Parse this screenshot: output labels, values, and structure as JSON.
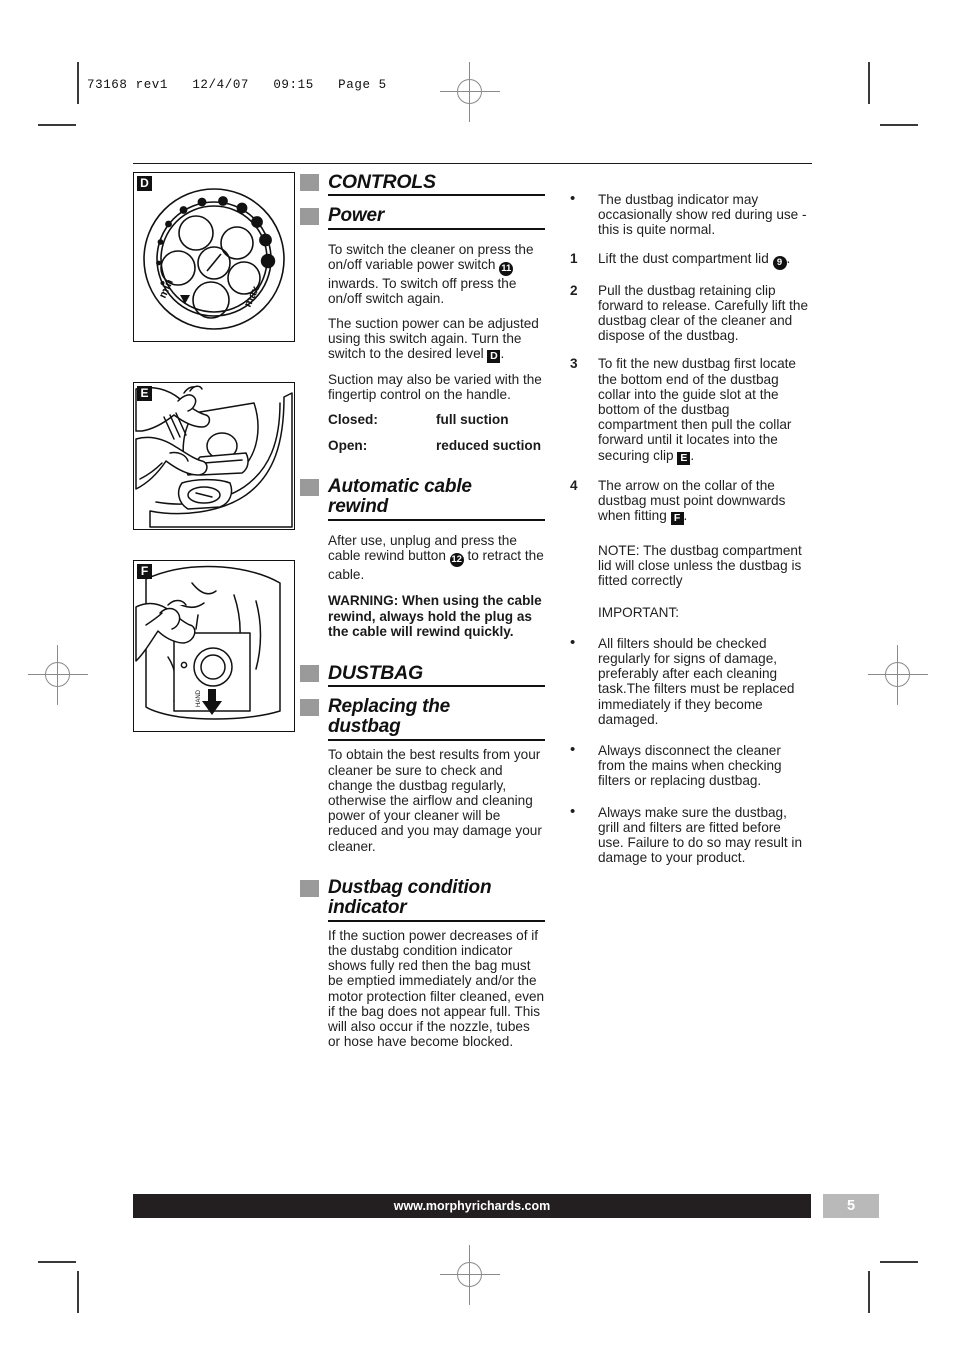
{
  "prepress": {
    "header_line": "73168 rev1   12/4/07   09:15   Page 5"
  },
  "figures": [
    {
      "label": "D",
      "caption_name": "power-dial-diagram"
    },
    {
      "label": "E",
      "caption_name": "dustbag-securing-clip-diagram"
    },
    {
      "label": "F",
      "caption_name": "dustbag-collar-arrow-diagram"
    }
  ],
  "figure_dial": {
    "min_label": "min",
    "max_label": "max"
  },
  "middle_column": {
    "controls_heading": "CONTROLS",
    "power_heading": "Power",
    "power_p1_a": "To switch the cleaner on press the on/off variable power switch ",
    "power_p1_badge": "11",
    "power_p1_b": " inwards. To switch off press the on/off switch again.",
    "power_p2_a": "The suction power can be adjusted using this switch again. Turn the switch to the desired level ",
    "power_p2_badge": "D",
    "power_p2_b": ".",
    "power_p3": "Suction may also be varied with the fingertip control on the handle.",
    "closed_key": "Closed:",
    "closed_value": "full suction",
    "open_key": "Open:",
    "open_value": "reduced suction",
    "rewind_heading": "Automatic cable\nrewind",
    "rewind_p1_a": "After use, unplug and press the cable rewind button ",
    "rewind_p1_badge": "12",
    "rewind_p1_b": " to retract the cable.",
    "rewind_warning": "WARNING: When using the cable rewind, always hold the plug as the cable will rewind quickly.",
    "dustbag_heading": "DUSTBAG",
    "replacing_heading": "Replacing the\ndustbag",
    "replacing_p1": "To obtain the best results from your cleaner be sure to check and change the dustbag regularly, otherwise the airflow and cleaning power of your cleaner will  be reduced and you may damage your cleaner.",
    "indicator_heading": "Dustbag condition\nindicator",
    "indicator_p1": "If the suction power decreases of if the dustabg condition indicator shows fully red then the bag must be emptied immediately and/or the motor protection filter cleaned, even if the bag does not appear full. This will also occur if the nozzle, tubes or hose have become blocked."
  },
  "right_column": {
    "items": [
      {
        "marker": "•",
        "marker_type": "dot",
        "text": "The dustbag indicator may occasionally show red during use - this is quite normal."
      },
      {
        "marker": "1",
        "marker_type": "num",
        "text_a": "Lift the dust compartment lid ",
        "badge": "9",
        "text_b": "."
      },
      {
        "marker": "2",
        "marker_type": "num",
        "text": "Pull the dustbag retaining clip forward to release. Carefully lift the dustbag clear of the cleaner and dispose of the dustbag."
      },
      {
        "marker": "3",
        "marker_type": "num",
        "text_a": "To fit the new dustbag first locate the bottom end of the dustbag collar into the guide slot at the bottom of the dustbag compartment then pull the collar forward until it locates into the securing clip ",
        "badge": "E",
        "badge_style": "letter",
        "text_b": "."
      },
      {
        "marker": "4",
        "marker_type": "num",
        "text_a": "The arrow on the collar of the dustbag must point downwards when fitting ",
        "badge": "F",
        "badge_style": "letter",
        "text_b": "."
      }
    ],
    "note": "NOTE: The dustbag compartment lid will close unless the dustbag is fitted correctly",
    "important": "IMPORTANT:",
    "bullets": [
      "All filters should be checked regularly for signs of damage, preferably after each cleaning task.The filters must be replaced immediately if they become damaged.",
      "Always disconnect the cleaner from the mains when checking filters or replacing dustbag.",
      "Always make sure the dustbag, grill and filters are fitted before use. Failure to do so may result in damage to your product."
    ],
    "bullet_marker": "•"
  },
  "footer": {
    "url": "www.morphyrichards.com",
    "page_number": "5"
  },
  "colors": {
    "heading_marker": "#9a9a9a",
    "footer_bar": "#231f20",
    "page_box": "#b9b9b9",
    "text": "#1f1f1f"
  }
}
